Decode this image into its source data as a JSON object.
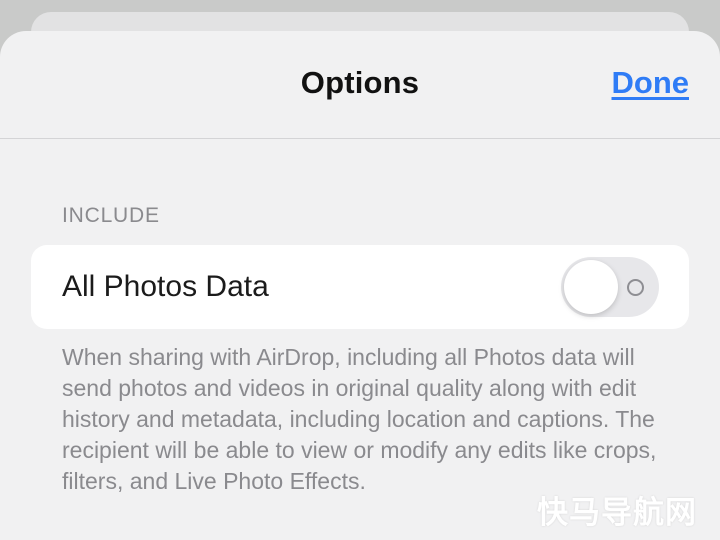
{
  "header": {
    "title": "Options",
    "done_label": "Done"
  },
  "section": {
    "header": "INCLUDE",
    "row_label": "All Photos Data",
    "toggle_on": false,
    "description": "When sharing with AirDrop, including all Photos data will send photos and videos in original quality along with edit history and metadata, including location and captions. The recipient will be able to view or modify any edits like crops, filters, and Live Photo Effects."
  },
  "watermark": "快马导航网",
  "colors": {
    "accent": "#2f7cf6",
    "background": "#f1f1f2",
    "card": "#ffffff",
    "secondary_text": "#8a8a8e"
  }
}
